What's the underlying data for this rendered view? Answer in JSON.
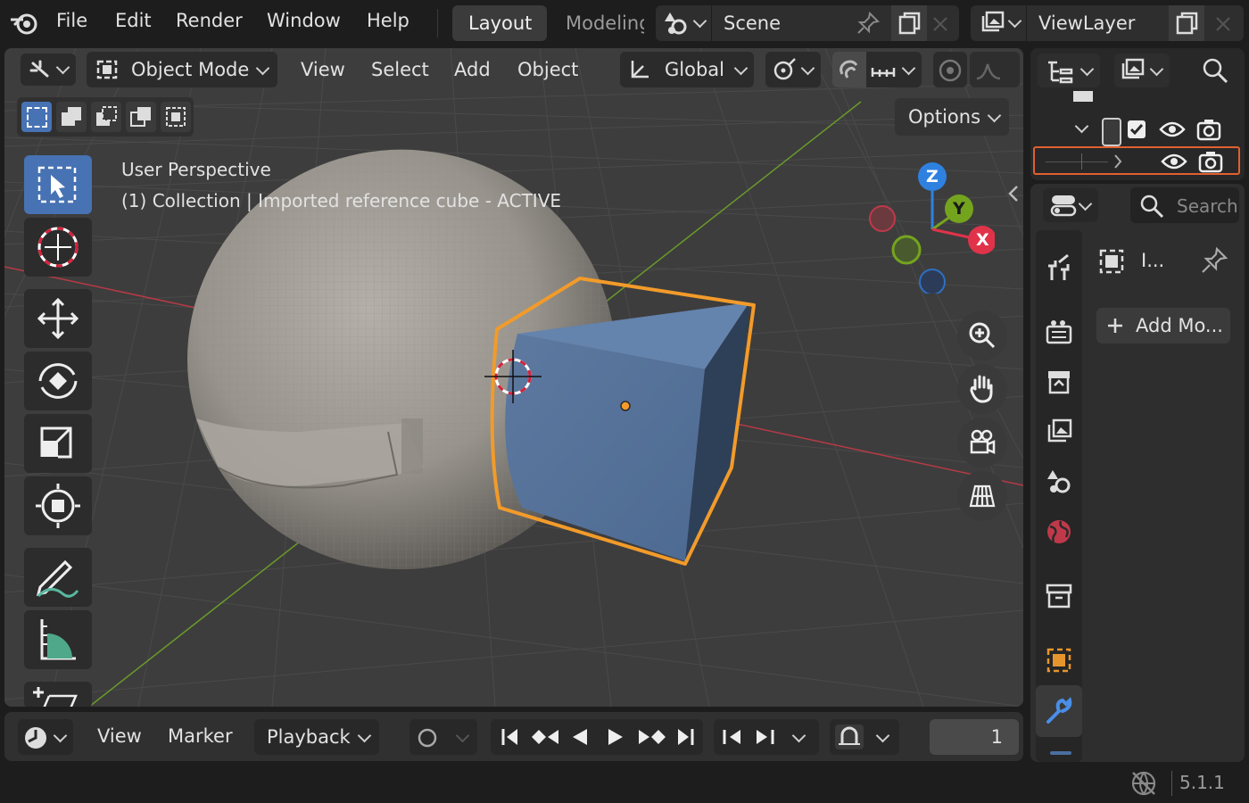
{
  "topbar": {
    "menus": [
      "File",
      "Edit",
      "Render",
      "Window",
      "Help"
    ],
    "workspace_tabs": [
      "Layout",
      "Modeling"
    ],
    "scene_name": "Scene",
    "view_layer": "ViewLayer"
  },
  "viewport_header": {
    "mode": "Object Mode",
    "menus": [
      "View",
      "Select",
      "Add",
      "Object"
    ],
    "orientation": "Global",
    "options_label": "Options"
  },
  "viewport": {
    "overlay_line1": "User Perspective",
    "overlay_line2_a": "(1) Collection",
    "overlay_line2_b": "Imported reference cube",
    "overlay_line2_c": "ACTIVE",
    "gizmo": {
      "x": "X",
      "y": "Y",
      "z": "Z"
    }
  },
  "timeline": {
    "menus": [
      "View",
      "Marker"
    ],
    "playback_label": "Playback",
    "current_frame": "1"
  },
  "properties": {
    "search_placeholder": "Search",
    "object_name": "I...",
    "add_modifier_label": "Add Mo..."
  },
  "status": {
    "version": "5.1.1"
  },
  "colors": {
    "accent": "#e6952c",
    "selection": "#4772b3",
    "outliner_highlight": "#e06030",
    "x_axis": "#e0334a",
    "y_axis": "#74a41e",
    "z_axis": "#2f81e0"
  }
}
